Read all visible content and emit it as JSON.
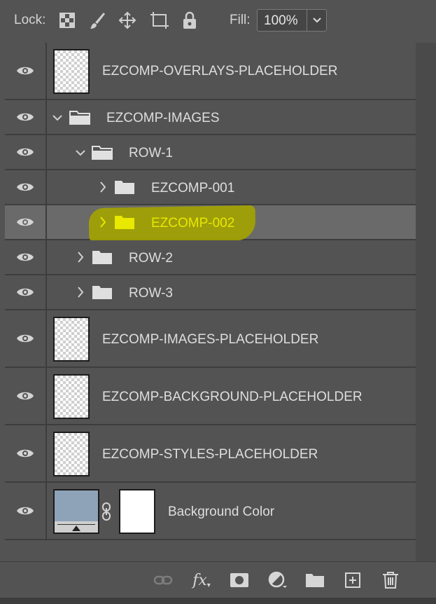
{
  "lock_bar": {
    "lock_label": "Lock:",
    "icons": [
      "lock-transparent-pixels-icon",
      "lock-image-pixels-icon",
      "lock-position-icon",
      "lock-artboard-icon",
      "lock-all-icon"
    ],
    "fill_label": "Fill:",
    "fill_value": "100%"
  },
  "layers": [
    {
      "name": "EZCOMP-OVERLAYS-PLACEHOLDER",
      "type": "pixel",
      "visible": true
    },
    {
      "name": "EZCOMP-IMAGES",
      "type": "group",
      "expanded": true,
      "visible": true
    },
    {
      "name": "ROW-1",
      "type": "group",
      "expanded": true,
      "visible": true
    },
    {
      "name": "EZCOMP-001",
      "type": "group",
      "expanded": false,
      "visible": true
    },
    {
      "name": "EZCOMP-002",
      "type": "group",
      "expanded": false,
      "visible": true,
      "selected": true
    },
    {
      "name": "ROW-2",
      "type": "group",
      "expanded": false,
      "visible": true
    },
    {
      "name": "ROW-3",
      "type": "group",
      "expanded": false,
      "visible": true
    },
    {
      "name": "EZCOMP-IMAGES-PLACEHOLDER",
      "type": "pixel",
      "visible": true
    },
    {
      "name": "EZCOMP-BACKGROUND-PLACEHOLDER",
      "type": "pixel",
      "visible": true
    },
    {
      "name": "EZCOMP-STYLES-PLACEHOLDER",
      "type": "pixel",
      "visible": true
    },
    {
      "name": "Background Color",
      "type": "fill",
      "visible": true
    }
  ],
  "bottom_tools": {
    "link": "link-layers-icon",
    "fx": "fx",
    "mask": "add-mask-icon",
    "adjustment": "adjustment-layer-icon",
    "group": "new-group-icon",
    "new_layer": "new-layer-icon",
    "delete": "delete-icon"
  },
  "colors": {
    "panel_bg": "#535353",
    "selected_row": "#6a6a6a",
    "highlight_text": "#e8e800",
    "fill_swatch": "#8ea3b8"
  }
}
